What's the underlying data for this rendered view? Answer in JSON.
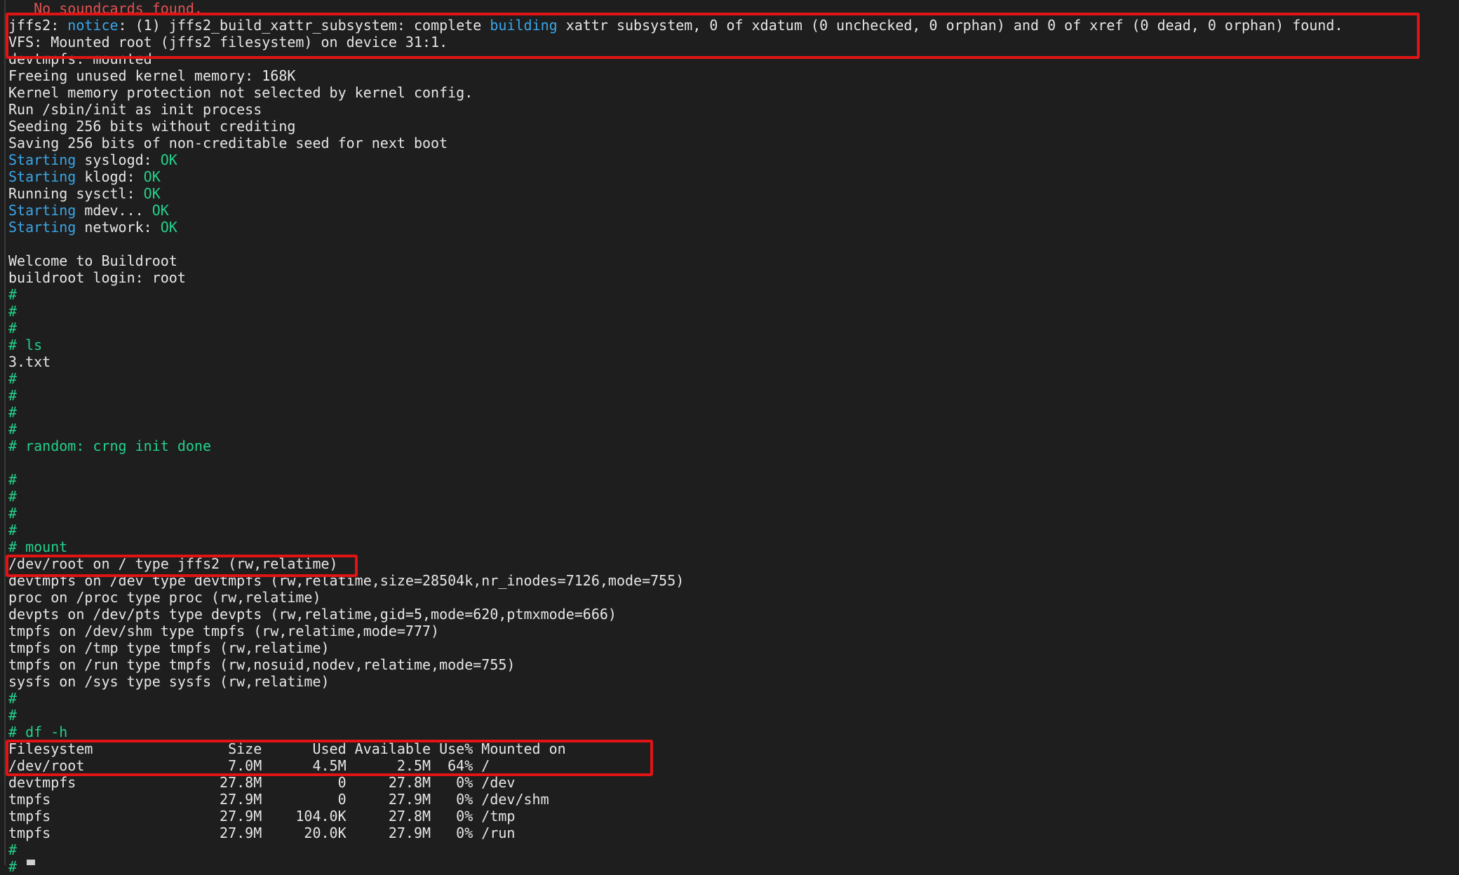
{
  "lines": [
    [
      {
        "t": "   No soundcards found.",
        "c": "c-red"
      }
    ],
    [
      {
        "t": "jffs2: ",
        "c": "c-default"
      },
      {
        "t": "notice",
        "c": "c-cyan"
      },
      {
        "t": ": (1) jffs2_build_xattr_subsystem: complete ",
        "c": "c-default"
      },
      {
        "t": "building",
        "c": "c-cyan"
      },
      {
        "t": " xattr subsystem, 0 of xdatum (0 unchecked, 0 orphan) and 0 of xref (0 dead, 0 orphan) found.",
        "c": "c-default"
      }
    ],
    [
      {
        "t": "VFS: Mounted root (jffs2 filesystem) on device 31:1.",
        "c": "c-default"
      }
    ],
    [
      {
        "t": "devtmpfs: mounted",
        "c": "c-default"
      }
    ],
    [
      {
        "t": "Freeing unused kernel memory: 168K",
        "c": "c-default"
      }
    ],
    [
      {
        "t": "Kernel memory protection not selected by kernel config.",
        "c": "c-default"
      }
    ],
    [
      {
        "t": "Run /sbin/init as init process",
        "c": "c-default"
      }
    ],
    [
      {
        "t": "Seeding 256 bits without crediting",
        "c": "c-default"
      }
    ],
    [
      {
        "t": "Saving 256 bits of non-creditable seed for next boot",
        "c": "c-default"
      }
    ],
    [
      {
        "t": "Starting",
        "c": "c-cyan"
      },
      {
        "t": " syslogd: ",
        "c": "c-default"
      },
      {
        "t": "OK",
        "c": "c-green"
      }
    ],
    [
      {
        "t": "Starting",
        "c": "c-cyan"
      },
      {
        "t": " klogd: ",
        "c": "c-default"
      },
      {
        "t": "OK",
        "c": "c-green"
      }
    ],
    [
      {
        "t": "Running sysctl: ",
        "c": "c-default"
      },
      {
        "t": "OK",
        "c": "c-green"
      }
    ],
    [
      {
        "t": "Starting",
        "c": "c-cyan"
      },
      {
        "t": " mdev... ",
        "c": "c-default"
      },
      {
        "t": "OK",
        "c": "c-green"
      }
    ],
    [
      {
        "t": "Starting",
        "c": "c-cyan"
      },
      {
        "t": " network: ",
        "c": "c-default"
      },
      {
        "t": "OK",
        "c": "c-green"
      }
    ],
    [],
    [
      {
        "t": "Welcome to Buildroot",
        "c": "c-default"
      }
    ],
    [
      {
        "t": "buildroot login: root",
        "c": "c-default"
      }
    ],
    [
      {
        "t": "#",
        "c": "c-green"
      }
    ],
    [
      {
        "t": "#",
        "c": "c-green"
      }
    ],
    [
      {
        "t": "#",
        "c": "c-green"
      }
    ],
    [
      {
        "t": "# ls",
        "c": "c-green"
      }
    ],
    [
      {
        "t": "3.txt",
        "c": "c-default"
      }
    ],
    [
      {
        "t": "#",
        "c": "c-green"
      }
    ],
    [
      {
        "t": "#",
        "c": "c-green"
      }
    ],
    [
      {
        "t": "#",
        "c": "c-green"
      }
    ],
    [
      {
        "t": "#",
        "c": "c-green"
      }
    ],
    [
      {
        "t": "# random: crng init done",
        "c": "c-green"
      }
    ],
    [],
    [
      {
        "t": "#",
        "c": "c-green"
      }
    ],
    [
      {
        "t": "#",
        "c": "c-green"
      }
    ],
    [
      {
        "t": "#",
        "c": "c-green"
      }
    ],
    [
      {
        "t": "#",
        "c": "c-green"
      }
    ],
    [
      {
        "t": "# mount",
        "c": "c-green"
      }
    ],
    [
      {
        "t": "/dev/root on / type jffs2 (rw,relatime)",
        "c": "c-default"
      }
    ],
    [
      {
        "t": "devtmpfs on /dev type devtmpfs (rw,relatime,size=28504k,nr_inodes=7126,mode=755)",
        "c": "c-default"
      }
    ],
    [
      {
        "t": "proc on /proc type proc (rw,relatime)",
        "c": "c-default"
      }
    ],
    [
      {
        "t": "devpts on /dev/pts type devpts (rw,relatime,gid=5,mode=620,ptmxmode=666)",
        "c": "c-default"
      }
    ],
    [
      {
        "t": "tmpfs on /dev/shm type tmpfs (rw,relatime,mode=777)",
        "c": "c-default"
      }
    ],
    [
      {
        "t": "tmpfs on /tmp type tmpfs (rw,relatime)",
        "c": "c-default"
      }
    ],
    [
      {
        "t": "tmpfs on /run type tmpfs (rw,nosuid,nodev,relatime,mode=755)",
        "c": "c-default"
      }
    ],
    [
      {
        "t": "sysfs on /sys type sysfs (rw,relatime)",
        "c": "c-default"
      }
    ],
    [
      {
        "t": "#",
        "c": "c-green"
      }
    ],
    [
      {
        "t": "#",
        "c": "c-green"
      }
    ],
    [
      {
        "t": "# df -h",
        "c": "c-green"
      }
    ],
    [
      {
        "t": "Filesystem                Size      Used Available Use% Mounted on",
        "c": "c-default"
      }
    ],
    [
      {
        "t": "/dev/root                 7.0M      4.5M      2.5M  64% /",
        "c": "c-default"
      }
    ],
    [
      {
        "t": "devtmpfs                 27.8M         0     27.8M   0% /dev",
        "c": "c-default"
      }
    ],
    [
      {
        "t": "tmpfs                    27.9M         0     27.9M   0% /dev/shm",
        "c": "c-default"
      }
    ],
    [
      {
        "t": "tmpfs                    27.9M    104.0K     27.8M   0% /tmp",
        "c": "c-default"
      }
    ],
    [
      {
        "t": "tmpfs                    27.9M     20.0K     27.9M   0% /run",
        "c": "c-default"
      }
    ],
    [
      {
        "t": "#",
        "c": "c-green"
      }
    ],
    [
      {
        "t": "#",
        "c": "c-green"
      }
    ]
  ],
  "highlights": [
    "jffs2-xattr-vfs-mount-box",
    "dev-root-mount-box",
    "df-root-box"
  ],
  "colors": {
    "background": "#1e1e1e",
    "text": "#e6e6e6",
    "cyan": "#3aa6e8",
    "green": "#23d18b",
    "highlight": "#e01414"
  }
}
